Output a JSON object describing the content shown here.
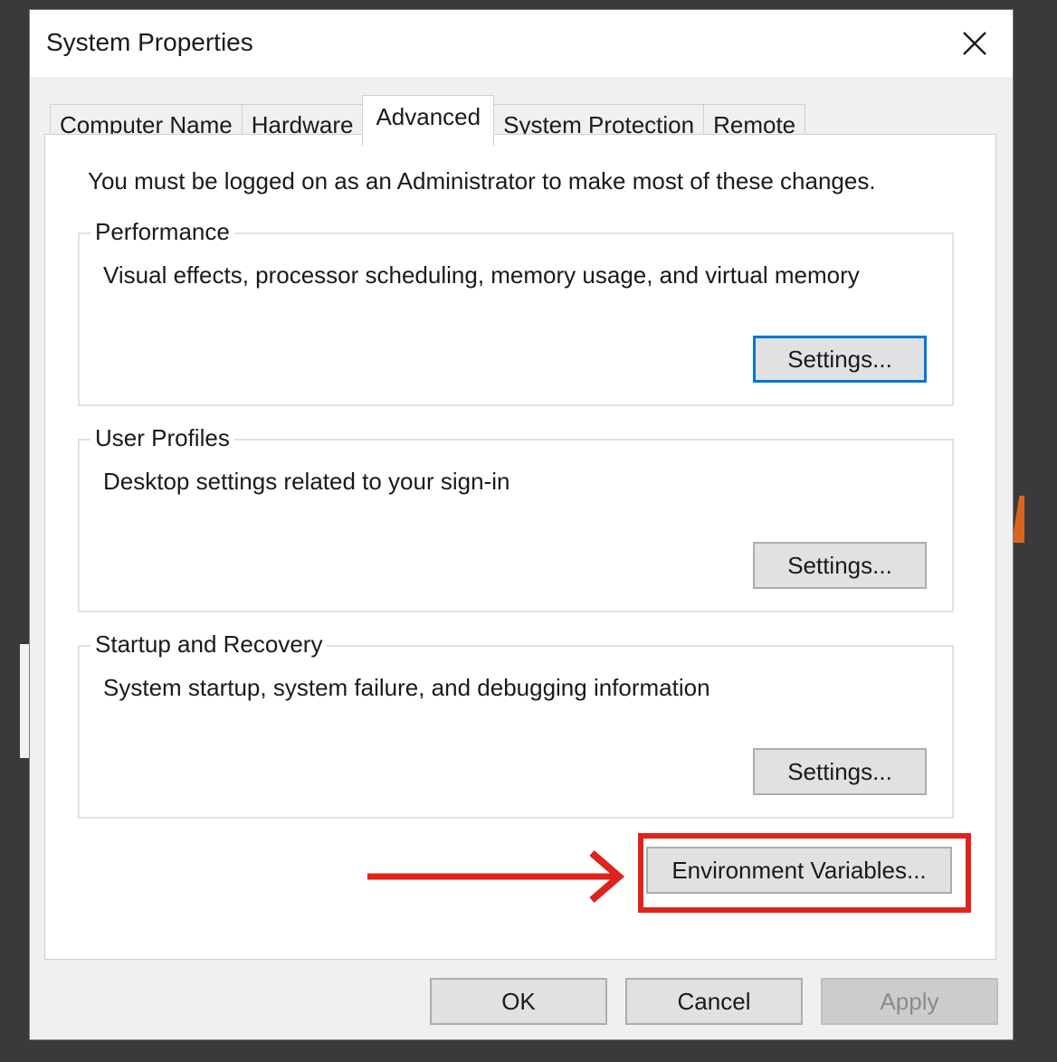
{
  "window": {
    "title": "System Properties",
    "close_icon": "close-icon"
  },
  "tabs": [
    {
      "label": "Computer Name",
      "active": false
    },
    {
      "label": "Hardware",
      "active": false
    },
    {
      "label": "Advanced",
      "active": true
    },
    {
      "label": "System Protection",
      "active": false
    },
    {
      "label": "Remote",
      "active": false
    }
  ],
  "advanced": {
    "admin_note": "You must be logged on as an Administrator to make most of these changes.",
    "performance": {
      "label": "Performance",
      "description": "Visual effects, processor scheduling, memory usage, and virtual memory",
      "button": "Settings..."
    },
    "user_profiles": {
      "label": "User Profiles",
      "description": "Desktop settings related to your sign-in",
      "button": "Settings..."
    },
    "startup_recovery": {
      "label": "Startup and Recovery",
      "description": "System startup, system failure, and debugging information",
      "button": "Settings..."
    },
    "env_button": "Environment Variables..."
  },
  "footer": {
    "ok": "OK",
    "cancel": "Cancel",
    "apply": "Apply"
  },
  "colors": {
    "highlight": "#e0231b",
    "focus_border": "#0078d7"
  }
}
